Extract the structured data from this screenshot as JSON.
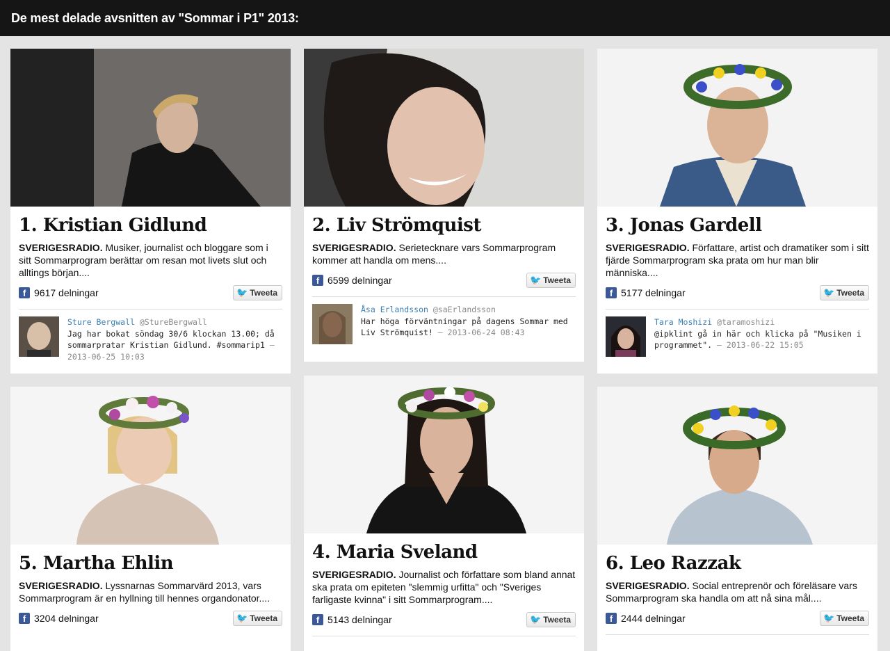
{
  "header": {
    "title": "De mest delade avsnitten av \"Sommar i P1\" 2013:"
  },
  "cards": [
    {
      "name": "1. Kristian Gidlund",
      "source": "SVERIGESRADIO.",
      "description": "Musiker, journalist och bloggare som i sitt Sommarprogram berättar om resan mot livets slut och alltings början....",
      "shares": "9617 delningar",
      "tweet_label": "Tweeta",
      "tweet": {
        "user": "Sture Bergwall",
        "handle": "@StureBergwall",
        "text": "Jag har bokat söndag 30/6 klockan 13.00; då sommarpratar Kristian Gidlund. #sommarip1",
        "time": "– 2013-06-25 10:03"
      }
    },
    {
      "name": "2. Liv Strömquist",
      "source": "SVERIGESRADIO.",
      "description": "Serietecknare vars Sommarprogram kommer att handla om mens....",
      "shares": "6599 delningar",
      "tweet_label": "Tweeta",
      "tweet": {
        "user": "Åsa Erlandsson",
        "handle": "@saErlandsson",
        "text": "Har höga förväntningar på dagens Sommar med Liv Strömquist!",
        "time": "– 2013-06-24 08:43"
      }
    },
    {
      "name": "3. Jonas Gardell",
      "source": "SVERIGESRADIO.",
      "description": "Författare, artist och dramatiker som i sitt fjärde Sommarprogram ska prata om hur man blir människa....",
      "shares": "5177 delningar",
      "tweet_label": "Tweeta",
      "tweet": {
        "user": "Tara Moshizi",
        "handle": "@taramoshizi",
        "text": "@ipklint gå in här och klicka på \"Musiken i programmet\".",
        "time": "– 2013-06-22 15:05"
      }
    },
    {
      "name": "5. Martha Ehlin",
      "source": "SVERIGESRADIO.",
      "description": "Lyssnarnas Sommarvärd 2013, vars Sommarprogram är en hyllning till hennes organdonator....",
      "shares": "3204 delningar",
      "tweet_label": "Tweeta"
    },
    {
      "name": "4. Maria Sveland",
      "source": "SVERIGESRADIO.",
      "description": "Journalist och författare som bland annat ska prata om epiteten \"slemmig urfitta\" och \"Sveriges farligaste kvinna\" i sitt Sommarprogram....",
      "shares": "5143 delningar",
      "tweet_label": "Tweeta"
    },
    {
      "name": "6. Leo Razzak",
      "source": "SVERIGESRADIO.",
      "description": "Social entreprenör och föreläsare vars Sommarprogram ska handla om att nå sina mål....",
      "shares": "2444 delningar",
      "tweet_label": "Tweeta"
    }
  ],
  "icons": {
    "facebook": "facebook-icon",
    "twitter": "twitter-bird-icon"
  },
  "colors": {
    "topbar": "#151515",
    "facebook": "#3b5998",
    "twitter": "#2aa3ef",
    "tweet_user": "#3a7fb5"
  }
}
